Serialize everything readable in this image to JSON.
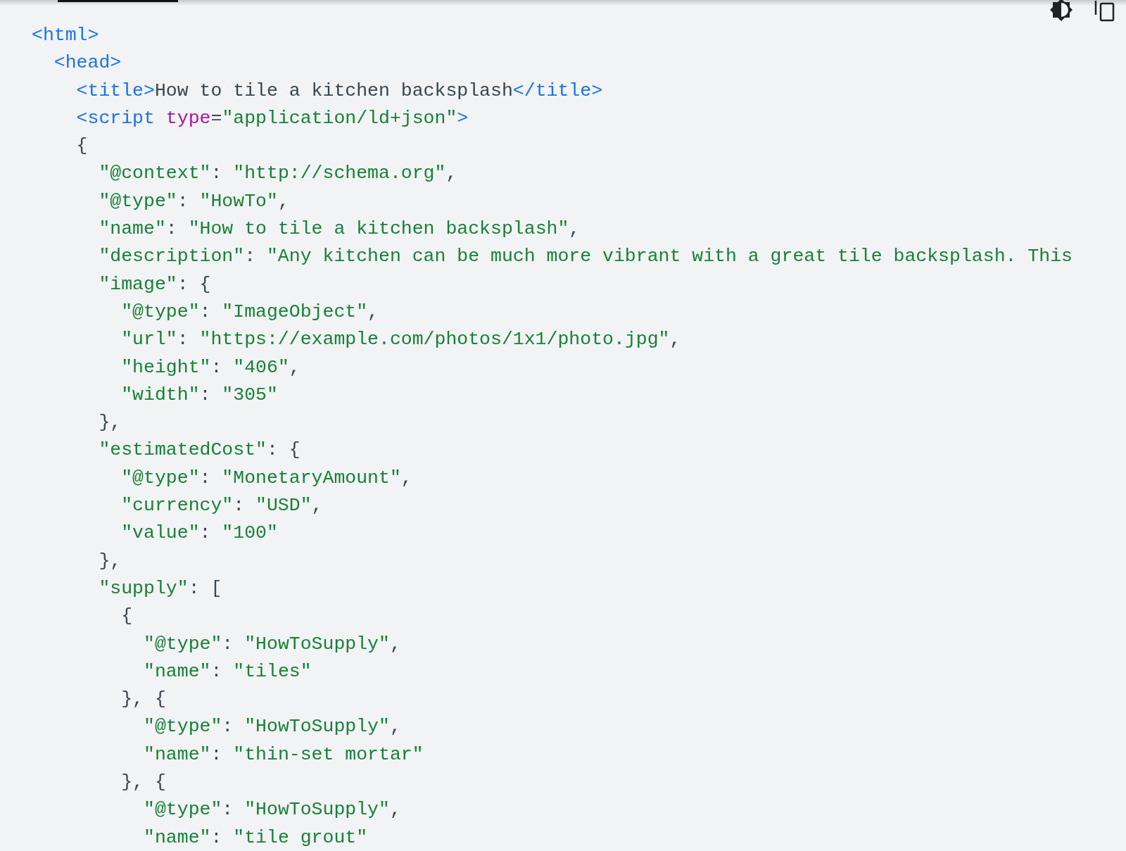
{
  "toolbar": {
    "active_tab": {
      "selected": true
    }
  },
  "code_lines": [
    {
      "tokens": [
        {
          "kind": "tag",
          "text": "<html>"
        }
      ]
    },
    {
      "tokens": [
        {
          "kind": "tag",
          "text": "  <head>"
        }
      ]
    },
    {
      "tokens": [
        {
          "kind": "tag",
          "text": "    <title>"
        },
        {
          "kind": "text",
          "text": "How to tile a kitchen backsplash"
        },
        {
          "kind": "tag",
          "text": "</title>"
        }
      ]
    },
    {
      "tokens": [
        {
          "kind": "tag",
          "text": "    <script "
        },
        {
          "kind": "attr",
          "text": "type"
        },
        {
          "kind": "text",
          "text": "="
        },
        {
          "kind": "str",
          "text": "\"application/ld+json\""
        },
        {
          "kind": "tag",
          "text": ">"
        }
      ]
    },
    {
      "tokens": [
        {
          "kind": "text",
          "text": "    {"
        }
      ]
    },
    {
      "tokens": [
        {
          "kind": "str",
          "text": "      \"@context\""
        },
        {
          "kind": "text",
          "text": ": "
        },
        {
          "kind": "str",
          "text": "\"http://schema.org\""
        },
        {
          "kind": "text",
          "text": ","
        }
      ]
    },
    {
      "tokens": [
        {
          "kind": "str",
          "text": "      \"@type\""
        },
        {
          "kind": "text",
          "text": ": "
        },
        {
          "kind": "str",
          "text": "\"HowTo\""
        },
        {
          "kind": "text",
          "text": ","
        }
      ]
    },
    {
      "tokens": [
        {
          "kind": "str",
          "text": "      \"name\""
        },
        {
          "kind": "text",
          "text": ": "
        },
        {
          "kind": "str",
          "text": "\"How to tile a kitchen backsplash\""
        },
        {
          "kind": "text",
          "text": ","
        }
      ]
    },
    {
      "tokens": [
        {
          "kind": "str",
          "text": "      \"description\""
        },
        {
          "kind": "text",
          "text": ": "
        },
        {
          "kind": "str",
          "text": "\"Any kitchen can be much more vibrant with a great tile backsplash. This"
        }
      ]
    },
    {
      "tokens": [
        {
          "kind": "str",
          "text": "      \"image\""
        },
        {
          "kind": "text",
          "text": ": {"
        }
      ]
    },
    {
      "tokens": [
        {
          "kind": "str",
          "text": "        \"@type\""
        },
        {
          "kind": "text",
          "text": ": "
        },
        {
          "kind": "str",
          "text": "\"ImageObject\""
        },
        {
          "kind": "text",
          "text": ","
        }
      ]
    },
    {
      "tokens": [
        {
          "kind": "str",
          "text": "        \"url\""
        },
        {
          "kind": "text",
          "text": ": "
        },
        {
          "kind": "str",
          "text": "\"https://example.com/photos/1x1/photo.jpg\""
        },
        {
          "kind": "text",
          "text": ","
        }
      ]
    },
    {
      "tokens": [
        {
          "kind": "str",
          "text": "        \"height\""
        },
        {
          "kind": "text",
          "text": ": "
        },
        {
          "kind": "str",
          "text": "\"406\""
        },
        {
          "kind": "text",
          "text": ","
        }
      ]
    },
    {
      "tokens": [
        {
          "kind": "str",
          "text": "        \"width\""
        },
        {
          "kind": "text",
          "text": ": "
        },
        {
          "kind": "str",
          "text": "\"305\""
        }
      ]
    },
    {
      "tokens": [
        {
          "kind": "text",
          "text": "      },"
        }
      ]
    },
    {
      "tokens": [
        {
          "kind": "str",
          "text": "      \"estimatedCost\""
        },
        {
          "kind": "text",
          "text": ": {"
        }
      ]
    },
    {
      "tokens": [
        {
          "kind": "str",
          "text": "        \"@type\""
        },
        {
          "kind": "text",
          "text": ": "
        },
        {
          "kind": "str",
          "text": "\"MonetaryAmount\""
        },
        {
          "kind": "text",
          "text": ","
        }
      ]
    },
    {
      "tokens": [
        {
          "kind": "str",
          "text": "        \"currency\""
        },
        {
          "kind": "text",
          "text": ": "
        },
        {
          "kind": "str",
          "text": "\"USD\""
        },
        {
          "kind": "text",
          "text": ","
        }
      ]
    },
    {
      "tokens": [
        {
          "kind": "str",
          "text": "        \"value\""
        },
        {
          "kind": "text",
          "text": ": "
        },
        {
          "kind": "str",
          "text": "\"100\""
        }
      ]
    },
    {
      "tokens": [
        {
          "kind": "text",
          "text": "      },"
        }
      ]
    },
    {
      "tokens": [
        {
          "kind": "str",
          "text": "      \"supply\""
        },
        {
          "kind": "text",
          "text": ": ["
        }
      ]
    },
    {
      "tokens": [
        {
          "kind": "text",
          "text": "        {"
        }
      ]
    },
    {
      "tokens": [
        {
          "kind": "str",
          "text": "          \"@type\""
        },
        {
          "kind": "text",
          "text": ": "
        },
        {
          "kind": "str",
          "text": "\"HowToSupply\""
        },
        {
          "kind": "text",
          "text": ","
        }
      ]
    },
    {
      "tokens": [
        {
          "kind": "str",
          "text": "          \"name\""
        },
        {
          "kind": "text",
          "text": ": "
        },
        {
          "kind": "str",
          "text": "\"tiles\""
        }
      ]
    },
    {
      "tokens": [
        {
          "kind": "text",
          "text": "        }, {"
        }
      ]
    },
    {
      "tokens": [
        {
          "kind": "str",
          "text": "          \"@type\""
        },
        {
          "kind": "text",
          "text": ": "
        },
        {
          "kind": "str",
          "text": "\"HowToSupply\""
        },
        {
          "kind": "text",
          "text": ","
        }
      ]
    },
    {
      "tokens": [
        {
          "kind": "str",
          "text": "          \"name\""
        },
        {
          "kind": "text",
          "text": ": "
        },
        {
          "kind": "str",
          "text": "\"thin-set mortar\""
        }
      ]
    },
    {
      "tokens": [
        {
          "kind": "text",
          "text": "        }, {"
        }
      ]
    },
    {
      "tokens": [
        {
          "kind": "str",
          "text": "          \"@type\""
        },
        {
          "kind": "text",
          "text": ": "
        },
        {
          "kind": "str",
          "text": "\"HowToSupply\""
        },
        {
          "kind": "text",
          "text": ","
        }
      ]
    },
    {
      "tokens": [
        {
          "kind": "str",
          "text": "          \"name\""
        },
        {
          "kind": "text",
          "text": ": "
        },
        {
          "kind": "str",
          "text": "\"tile grout\""
        }
      ]
    }
  ]
}
